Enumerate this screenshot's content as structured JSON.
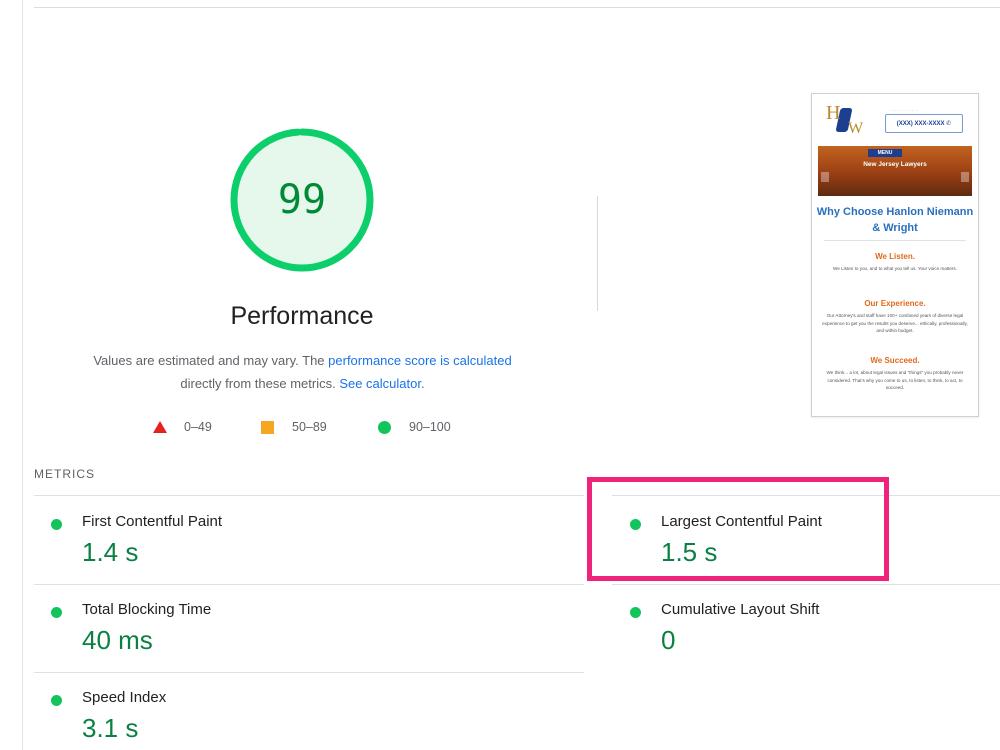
{
  "performance": {
    "score": "99",
    "score_fraction": 0.99,
    "title": "Performance",
    "desc_text_1": "Values are estimated and may vary. The ",
    "desc_link_1": "performance score is calculated",
    "desc_text_2": "directly from these metrics. ",
    "desc_link_2": "See calculator",
    "desc_text_3": ".",
    "colors": {
      "pass": "#0cce6b",
      "pass_fill": "#e6f7ec",
      "pass_text": "#008a36"
    }
  },
  "legend": [
    {
      "shape": "triangle",
      "label": "0–49",
      "color": "#e5221c"
    },
    {
      "shape": "square",
      "label": "50–89",
      "color": "#f5a623"
    },
    {
      "shape": "circle",
      "label": "90–100",
      "color": "#12c45b"
    }
  ],
  "thumbnail": {
    "logo_h": "H",
    "logo_w": "W",
    "phone": "(XXX) XXX-XXXX",
    "banner_menu": "MENU",
    "banner_title": "New Jersey Lawyers",
    "heading": "Why Choose Hanlon Niemann & Wright",
    "section_1_title": "We Listen.",
    "section_1_text": "We Listen to you, and to what you tell us. Your voice matters.",
    "section_2_title": "Our Experience.",
    "section_2_text": "Our Attorney's and staff have 100+ combined years of diverse legal experience to get you the results you deserve... ethically, professionally, and within budget.",
    "section_3_title": "We Succeed.",
    "section_3_text": "We think... a lot, about legal issues and \"things\" you probably never considered. That's why you come to us, to listen, to think, to act, to succeed."
  },
  "metrics": {
    "section_label": "METRICS",
    "items": [
      {
        "label": "First Contentful Paint",
        "value": "1.4 s"
      },
      {
        "label": "Largest Contentful Paint",
        "value": "1.5 s"
      },
      {
        "label": "Total Blocking Time",
        "value": "40 ms"
      },
      {
        "label": "Cumulative Layout Shift",
        "value": "0"
      },
      {
        "label": "Speed Index",
        "value": "3.1 s"
      }
    ],
    "highlight_color": "#f0237a"
  }
}
